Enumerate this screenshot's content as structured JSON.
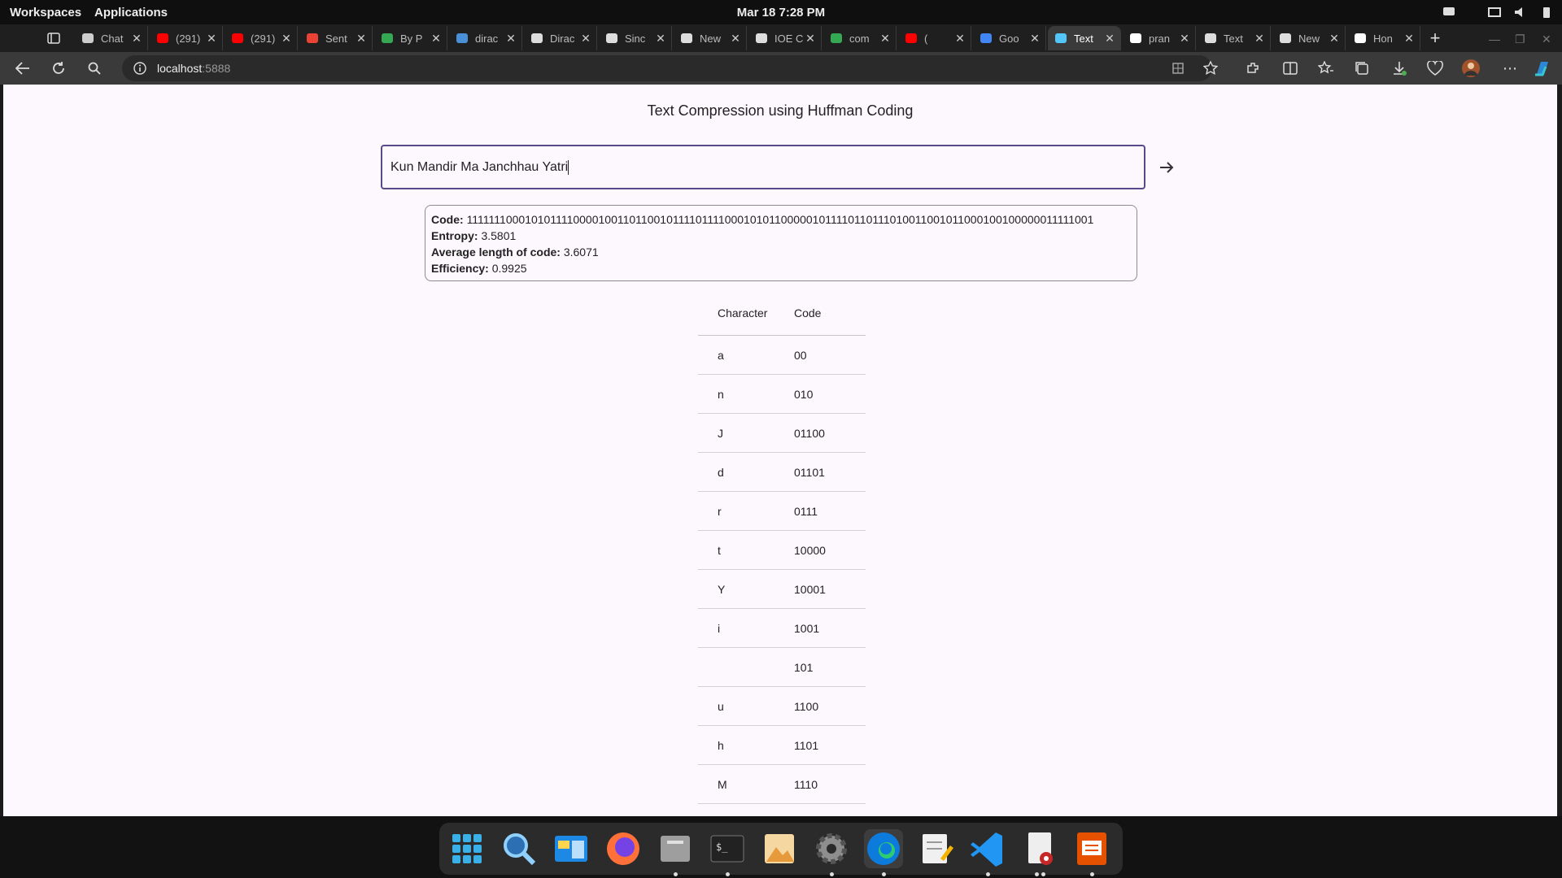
{
  "desktop": {
    "workspaces": "Workspaces",
    "applications": "Applications",
    "datetime": "Mar 18   7:28 PM"
  },
  "browser": {
    "tabs": [
      {
        "label": "Chat",
        "icon": "chatgpt-icon",
        "active": false
      },
      {
        "label": "(291)",
        "icon": "youtube-icon",
        "active": false
      },
      {
        "label": "(291)",
        "icon": "youtube-icon",
        "active": false
      },
      {
        "label": "Sent",
        "icon": "gmail-icon",
        "active": false
      },
      {
        "label": "By P",
        "icon": "google-drive-icon",
        "active": false
      },
      {
        "label": "dirac",
        "icon": "search-icon",
        "active": false
      },
      {
        "label": "Dirac",
        "icon": "wikipedia-icon",
        "active": false
      },
      {
        "label": "Sinc",
        "icon": "wikipedia-icon",
        "active": false
      },
      {
        "label": "New",
        "icon": "newtab-icon",
        "active": false
      },
      {
        "label": "IOE C",
        "icon": "document-icon",
        "active": false
      },
      {
        "label": "com",
        "icon": "google-drive-icon",
        "active": false
      },
      {
        "label": "(",
        "icon": "youtube-icon",
        "active": false
      },
      {
        "label": "Goo",
        "icon": "google-icon",
        "active": false
      },
      {
        "label": "Text",
        "icon": "flutter-icon",
        "active": true
      },
      {
        "label": "pran",
        "icon": "github-icon",
        "active": false
      },
      {
        "label": "Text",
        "icon": "document-icon",
        "active": false
      },
      {
        "label": "New",
        "icon": "newtab-icon",
        "active": false
      },
      {
        "label": "Hon",
        "icon": "x-icon",
        "active": false
      }
    ],
    "url_host": "localhost",
    "url_port": ":5888"
  },
  "page": {
    "title": "Text Compression using Huffman Coding",
    "input_value": "Kun Mandir Ma Janchhau Yatri",
    "result": {
      "code_label": "Code:",
      "code_value": "1111111000101011110000100110110010111101111000101011000001011110110111010011001011000100100000011111001",
      "entropy_label": "Entropy:",
      "entropy_value": "3.5801",
      "avg_label": "Average length of code:",
      "avg_value": "3.6071",
      "eff_label": "Efficiency:",
      "eff_value": "0.9925"
    },
    "table": {
      "headers": [
        "Character",
        "Code"
      ],
      "rows": [
        {
          "char": "a",
          "code": "00"
        },
        {
          "char": "n",
          "code": "010"
        },
        {
          "char": "J",
          "code": "01100"
        },
        {
          "char": "d",
          "code": "01101"
        },
        {
          "char": "r",
          "code": "0111"
        },
        {
          "char": "t",
          "code": "10000"
        },
        {
          "char": "Y",
          "code": "10001"
        },
        {
          "char": "i",
          "code": "1001"
        },
        {
          "char": " ",
          "code": "101"
        },
        {
          "char": "u",
          "code": "1100"
        },
        {
          "char": "h",
          "code": "1101"
        },
        {
          "char": "M",
          "code": "1110"
        }
      ]
    }
  },
  "dock": {
    "apps": [
      "app-grid-icon",
      "search-icon",
      "workspace-icon",
      "firefox-icon",
      "files-icon",
      "terminal-icon",
      "image-viewer-icon",
      "settings-icon",
      "edge-icon",
      "text-editor-icon",
      "vscode-icon",
      "document-viewer-icon",
      "presentation-icon"
    ]
  },
  "colors": {
    "accent": "#5a4a8c",
    "page_bg": "#fdf8fe",
    "browser_bg": "#3a3a3a"
  }
}
